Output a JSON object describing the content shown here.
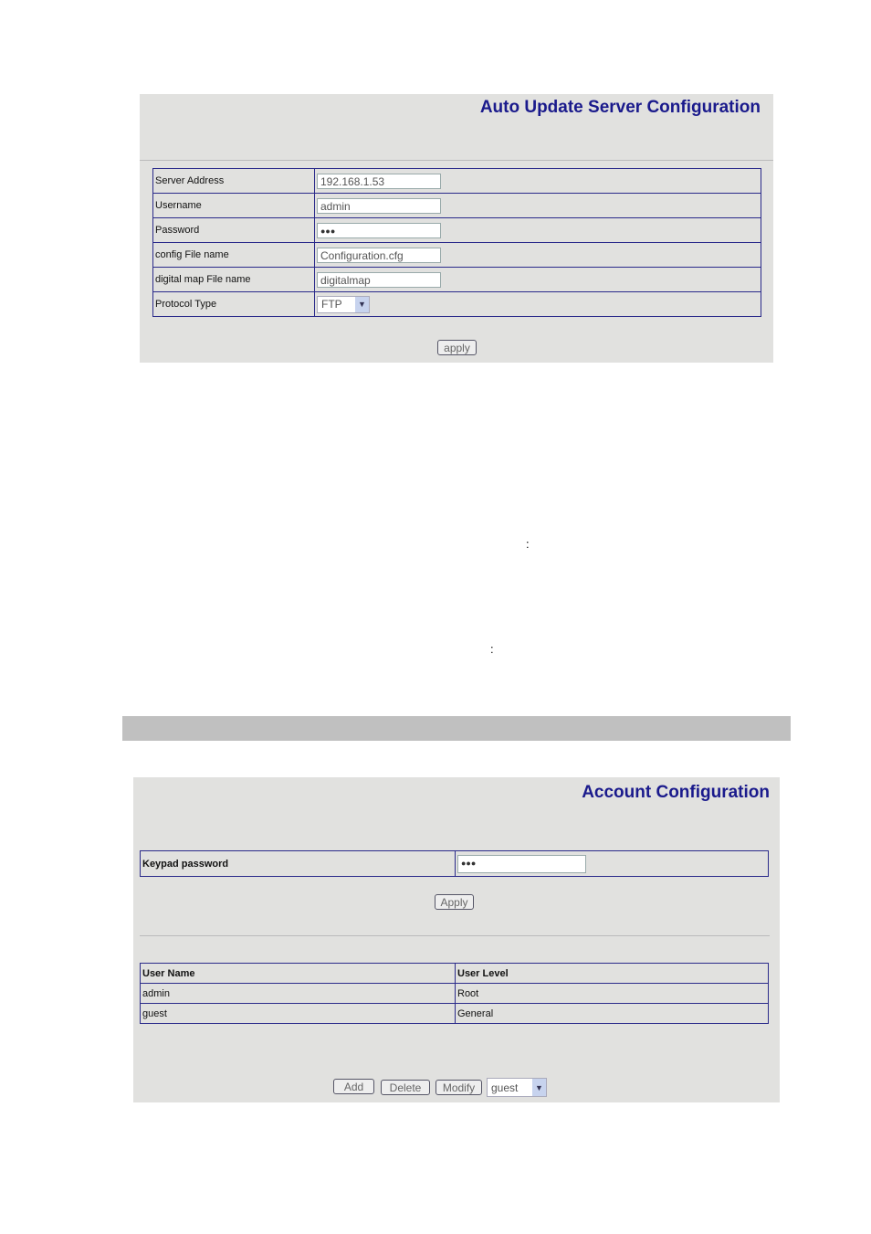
{
  "auto_update": {
    "title": "Auto Update Server Configuration",
    "rows": [
      {
        "label": "Server Address",
        "value": "192.168.1.53"
      },
      {
        "label": "Username",
        "value": "admin"
      },
      {
        "label": "Password",
        "value": "●●●"
      },
      {
        "label": "config File name",
        "value": "Configuration.cfg"
      },
      {
        "label": "digital map File name",
        "value": "digitalmap"
      },
      {
        "label": "Protocol Type",
        "value": "FTP"
      }
    ],
    "apply_label": "apply"
  },
  "colons": [
    ":",
    ":"
  ],
  "account": {
    "title": "Account Configuration",
    "keypad_label": "Keypad password",
    "keypad_value": "●●●",
    "apply_label": "Apply",
    "headers": [
      "User Name",
      "User Level"
    ],
    "users": [
      {
        "name": "admin",
        "level": "Root"
      },
      {
        "name": "guest",
        "level": "General"
      }
    ],
    "add_label": "Add",
    "delete_label": "Delete",
    "modify_label": "Modify",
    "selected_user": "guest"
  }
}
